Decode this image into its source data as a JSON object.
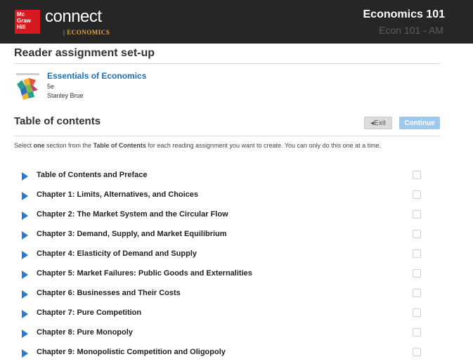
{
  "header": {
    "logo_text": "Mc\nGraw\nHill",
    "brand": "connect",
    "brand_sub": "| ECONOMICS",
    "course_title": "Economics 101",
    "course_section": "Econ 101 - AM"
  },
  "page": {
    "title": "Reader assignment set-up"
  },
  "book": {
    "title": "Essentials of Economics",
    "edition": "5e",
    "author": "Stanley Brue"
  },
  "toc": {
    "title": "Table of contents",
    "exit_label": "◂Exit",
    "continue_label": "Continue",
    "instructions_pre": "Select ",
    "instructions_bold1": "one",
    "instructions_mid": " section from the ",
    "instructions_bold2": "Table of Contents",
    "instructions_post": " for each reading assignment you want to create. You can only do this one at a time.",
    "items": [
      {
        "label": "Table of Contents and Preface"
      },
      {
        "label": "Chapter 1: Limits, Alternatives, and Choices"
      },
      {
        "label": "Chapter 2: The Market System and the Circular Flow"
      },
      {
        "label": "Chapter 3: Demand, Supply, and Market Equilibrium"
      },
      {
        "label": "Chapter 4: Elasticity of Demand and Supply"
      },
      {
        "label": "Chapter 5: Market Failures: Public Goods and Externalities"
      },
      {
        "label": "Chapter 6: Businesses and Their Costs"
      },
      {
        "label": "Chapter 7: Pure Competition"
      },
      {
        "label": "Chapter 8: Pure Monopoly"
      },
      {
        "label": "Chapter 9: Monopolistic Competition and Oligopoly"
      }
    ]
  },
  "colors": {
    "header_bg": "#262626",
    "link_blue": "#1f6fb5",
    "arrow_blue": "#2a7bd0",
    "continue_bg": "#9ec9ec",
    "logo_red": "#d71920"
  }
}
